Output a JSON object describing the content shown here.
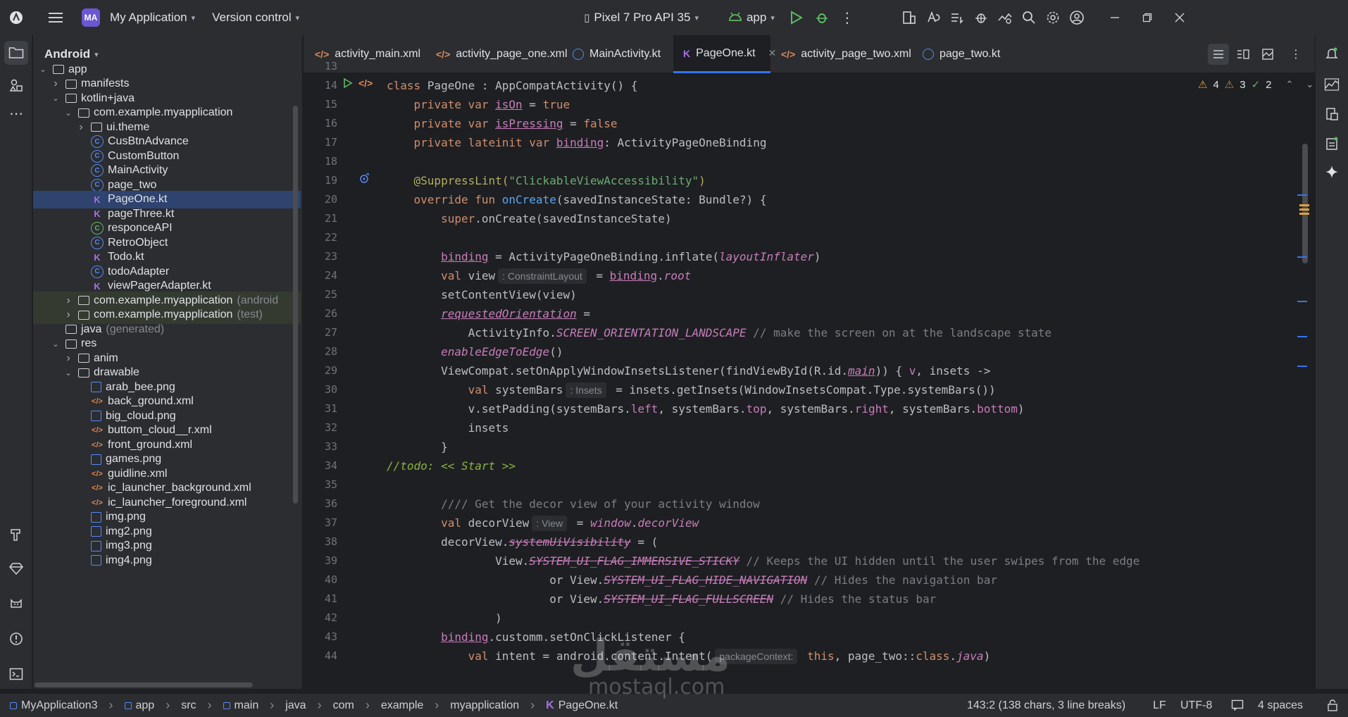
{
  "topbar": {
    "project_badge": "MA",
    "project_name": "My Application",
    "vcs_label": "Version control",
    "device": "Pixel 7 Pro API 35",
    "run_config": "app"
  },
  "project_panel": {
    "view_mode": "Android",
    "tree": [
      {
        "label": "app",
        "suffix": "",
        "icon": "folder",
        "depth": 0,
        "arrow": "down"
      },
      {
        "label": "manifests",
        "suffix": "",
        "icon": "folder",
        "depth": 1,
        "arrow": "right"
      },
      {
        "label": "kotlin+java",
        "suffix": "",
        "icon": "folder",
        "depth": 1,
        "arrow": "down"
      },
      {
        "label": "com.example.myapplication",
        "suffix": "",
        "icon": "folder",
        "depth": 2,
        "arrow": "down"
      },
      {
        "label": "ui.theme",
        "suffix": "",
        "icon": "folder",
        "depth": 3,
        "arrow": "right"
      },
      {
        "label": "CusBtnAdvance",
        "suffix": "",
        "icon": "class",
        "depth": 3,
        "arrow": ""
      },
      {
        "label": "CustomButton",
        "suffix": "",
        "icon": "class",
        "depth": 3,
        "arrow": ""
      },
      {
        "label": "MainActivity",
        "suffix": "",
        "icon": "class",
        "depth": 3,
        "arrow": ""
      },
      {
        "label": "page_two",
        "suffix": "",
        "icon": "class",
        "depth": 3,
        "arrow": ""
      },
      {
        "label": "PageOne.kt",
        "suffix": "",
        "icon": "kt",
        "depth": 3,
        "arrow": "",
        "selected": true
      },
      {
        "label": "pageThree.kt",
        "suffix": "",
        "icon": "kt",
        "depth": 3,
        "arrow": ""
      },
      {
        "label": "responceAPI",
        "suffix": "",
        "icon": "class-g",
        "depth": 3,
        "arrow": ""
      },
      {
        "label": "RetroObject",
        "suffix": "",
        "icon": "class",
        "depth": 3,
        "arrow": ""
      },
      {
        "label": "Todo.kt",
        "suffix": "",
        "icon": "kt",
        "depth": 3,
        "arrow": ""
      },
      {
        "label": "todoAdapter",
        "suffix": "",
        "icon": "class",
        "depth": 3,
        "arrow": ""
      },
      {
        "label": "viewPagerAdapter.kt",
        "suffix": "",
        "icon": "kt",
        "depth": 3,
        "arrow": ""
      },
      {
        "label": "com.example.myapplication",
        "suffix": "(android",
        "icon": "folder",
        "depth": 2,
        "arrow": "right",
        "highlight": true
      },
      {
        "label": "com.example.myapplication",
        "suffix": "(test)",
        "icon": "folder",
        "depth": 2,
        "arrow": "right",
        "highlight": true
      },
      {
        "label": "java",
        "suffix": "(generated)",
        "icon": "folder",
        "depth": 1,
        "arrow": ""
      },
      {
        "label": "res",
        "suffix": "",
        "icon": "folder",
        "depth": 1,
        "arrow": "down"
      },
      {
        "label": "anim",
        "suffix": "",
        "icon": "folder",
        "depth": 2,
        "arrow": "right"
      },
      {
        "label": "drawable",
        "suffix": "",
        "icon": "folder",
        "depth": 2,
        "arrow": "down"
      },
      {
        "label": "arab_bee.png",
        "suffix": "",
        "icon": "img",
        "depth": 3,
        "arrow": ""
      },
      {
        "label": "back_ground.xml",
        "suffix": "",
        "icon": "xml",
        "depth": 3,
        "arrow": ""
      },
      {
        "label": "big_cloud.png",
        "suffix": "",
        "icon": "img",
        "depth": 3,
        "arrow": ""
      },
      {
        "label": "buttom_cloud__r.xml",
        "suffix": "",
        "icon": "xml",
        "depth": 3,
        "arrow": ""
      },
      {
        "label": "front_ground.xml",
        "suffix": "",
        "icon": "xml",
        "depth": 3,
        "arrow": ""
      },
      {
        "label": "games.png",
        "suffix": "",
        "icon": "img",
        "depth": 3,
        "arrow": ""
      },
      {
        "label": "guidline.xml",
        "suffix": "",
        "icon": "xml",
        "depth": 3,
        "arrow": ""
      },
      {
        "label": "ic_launcher_background.xml",
        "suffix": "",
        "icon": "xml",
        "depth": 3,
        "arrow": ""
      },
      {
        "label": "ic_launcher_foreground.xml",
        "suffix": "",
        "icon": "xml",
        "depth": 3,
        "arrow": ""
      },
      {
        "label": "img.png",
        "suffix": "",
        "icon": "img",
        "depth": 3,
        "arrow": ""
      },
      {
        "label": "img2.png",
        "suffix": "",
        "icon": "img",
        "depth": 3,
        "arrow": ""
      },
      {
        "label": "img3.png",
        "suffix": "",
        "icon": "img",
        "depth": 3,
        "arrow": ""
      },
      {
        "label": "img4.png",
        "suffix": "",
        "icon": "img",
        "depth": 3,
        "arrow": ""
      }
    ]
  },
  "tabs": [
    {
      "label": "activity_main.xml",
      "icon": "xml"
    },
    {
      "label": "activity_page_one.xml",
      "icon": "xml"
    },
    {
      "label": "MainActivity.kt",
      "icon": "class"
    },
    {
      "label": "PageOne.kt",
      "icon": "kt",
      "active": true
    },
    {
      "label": "activity_page_two.xml",
      "icon": "xml"
    },
    {
      "label": "page_two.kt",
      "icon": "class"
    }
  ],
  "inspections": {
    "warnings_a": "4",
    "warnings_b": "3",
    "weak": "2"
  },
  "line_numbers": [
    "13",
    "14",
    "15",
    "16",
    "17",
    "18",
    "19",
    "20",
    "21",
    "22",
    "23",
    "24",
    "25",
    "26",
    "27",
    "28",
    "29",
    "30",
    "31",
    "32",
    "33",
    "34",
    "35",
    "36",
    "37",
    "38",
    "39",
    "40",
    "41",
    "42",
    "43",
    "44"
  ],
  "code": {
    "l14": {
      "a": "class ",
      "b": "PageOne : AppCompatActivity() {"
    },
    "l15": {
      "a": "private var ",
      "b": "isOn",
      "c": " = ",
      "d": "true"
    },
    "l16": {
      "a": "private var ",
      "b": "isPressing",
      "c": " = ",
      "d": "false"
    },
    "l17": {
      "a": "private lateinit var ",
      "b": "binding",
      "c": ": ActivityPageOneBinding"
    },
    "l19": {
      "a": "@SuppressLint(",
      "b": "\"ClickableViewAccessibility\"",
      "c": ")"
    },
    "l20": {
      "a": "override fun ",
      "b": "onCreate",
      "c": "(savedInstanceState: Bundle?) {"
    },
    "l21": {
      "a": "super",
      "b": ".onCreate(savedInstanceState)"
    },
    "l23": {
      "a": "binding",
      "b": " = ActivityPageOneBinding.inflate(",
      "c": "layoutInflater",
      "d": ")"
    },
    "l24": {
      "a": "val ",
      "b": "view",
      "hint": ": ConstraintLayout",
      "c": " = ",
      "d": "binding",
      "e": ".",
      "f": "root"
    },
    "l25": {
      "a": "setContentView(view)"
    },
    "l26": {
      "a": "requestedOrientation",
      "b": " ="
    },
    "l27": {
      "a": "ActivityInfo.",
      "b": "SCREEN_ORIENTATION_LANDSCAPE",
      "c": " // make the screen on at the landscape state"
    },
    "l28": {
      "a": "enableEdgeToEdge",
      "b": "()"
    },
    "l29": {
      "a": "ViewCompat.setOnApplyWindowInsetsListener(findViewById(R.id.",
      "b": "main",
      "c": ")) { ",
      "d": "v",
      "e": ", insets ->"
    },
    "l30": {
      "a": "val ",
      "b": "systemBars",
      "hint": ": Insets",
      "c": " = insets.getInsets(WindowInsetsCompat.Type.systemBars())"
    },
    "l31": {
      "a": "v.setPadding(systemBars.",
      "b": "left",
      "c": ", systemBars.",
      "d": "top",
      "e": ", systemBars.",
      "f": "right",
      "g": ", systemBars.",
      "h": "bottom",
      "i": ")"
    },
    "l32": {
      "a": "insets"
    },
    "l33": {
      "a": "}"
    },
    "l34": {
      "a": "//todo: << Start >>"
    },
    "l36": {
      "a": "//// Get the decor view of your activity window"
    },
    "l37": {
      "a": "val ",
      "b": "decorView",
      "hint": ": View",
      "c": " = ",
      "d": "window",
      "e": ".",
      "f": "decorView"
    },
    "l38": {
      "a": "decorView.",
      "b": "systemUiVisibility",
      "c": " = ("
    },
    "l39": {
      "a": "View.",
      "b": "SYSTEM_UI_FLAG_IMMERSIVE_STICKY",
      "c": " // Keeps the UI hidden until the user swipes from the edge"
    },
    "l40": {
      "a": "or View.",
      "b": "SYSTEM_UI_FLAG_HIDE_NAVIGATION",
      "c": " // Hides the navigation bar"
    },
    "l41": {
      "a": "or View.",
      "b": "SYSTEM_UI_FLAG_FULLSCREEN",
      "c": " // Hides the status bar"
    },
    "l42": {
      "a": ")"
    },
    "l43": {
      "a": "binding",
      "b": ".custom",
      "c": "m",
      "d": ".setOnClickListener {"
    },
    "l44": {
      "a": "val ",
      "b": "intent",
      "c": " = android.content.Intent(",
      "hint": "packageContext:",
      "d": " this",
      "e": ", page_two::",
      "f": "class",
      "g": ".",
      "h": "java",
      "i": ")"
    }
  },
  "statusbar": {
    "crumbs": [
      "MyApplication3",
      "app",
      "src",
      "main",
      "java",
      "com",
      "example",
      "myapplication",
      "PageOne.kt"
    ],
    "position": "143:2 (138 chars, 3 line breaks)",
    "line_sep": "LF",
    "encoding": "UTF-8",
    "indent": "4 spaces"
  },
  "watermark": {
    "arabic": "مستقل",
    "latin": "mostaql.com"
  },
  "colors": {
    "accent": "#3574f0",
    "keyword": "#cf8e6d",
    "function": "#56a8f5",
    "string": "#6aab73",
    "property": "#c77dbb",
    "annotation": "#b3ae60",
    "comment": "#7a7e85",
    "background": "#1e1f22",
    "panel": "#2b2d30"
  },
  "icons": {
    "topbar": [
      "android-studio-logo-icon",
      "hamburger-menu-icon",
      "device-icon",
      "android-icon",
      "run-icon",
      "debug-icon",
      "more-icon",
      "layout-icon",
      "translate-icon",
      "sync-icon",
      "gradle-icon",
      "profiler-icon",
      "search-icon",
      "settings-icon",
      "account-icon",
      "minimize-icon",
      "maximize-icon",
      "close-icon"
    ],
    "left_strip": [
      "folder-icon",
      "resource-manager-icon",
      "more-tools-icon",
      "build-icon",
      "gem-icon",
      "logcat-icon",
      "problems-icon",
      "terminal-icon",
      "git-icon"
    ],
    "right_strip": [
      "notifications-icon",
      "device-manager-icon",
      "running-devices-icon",
      "device-explorer-icon",
      "gemini-icon"
    ]
  }
}
